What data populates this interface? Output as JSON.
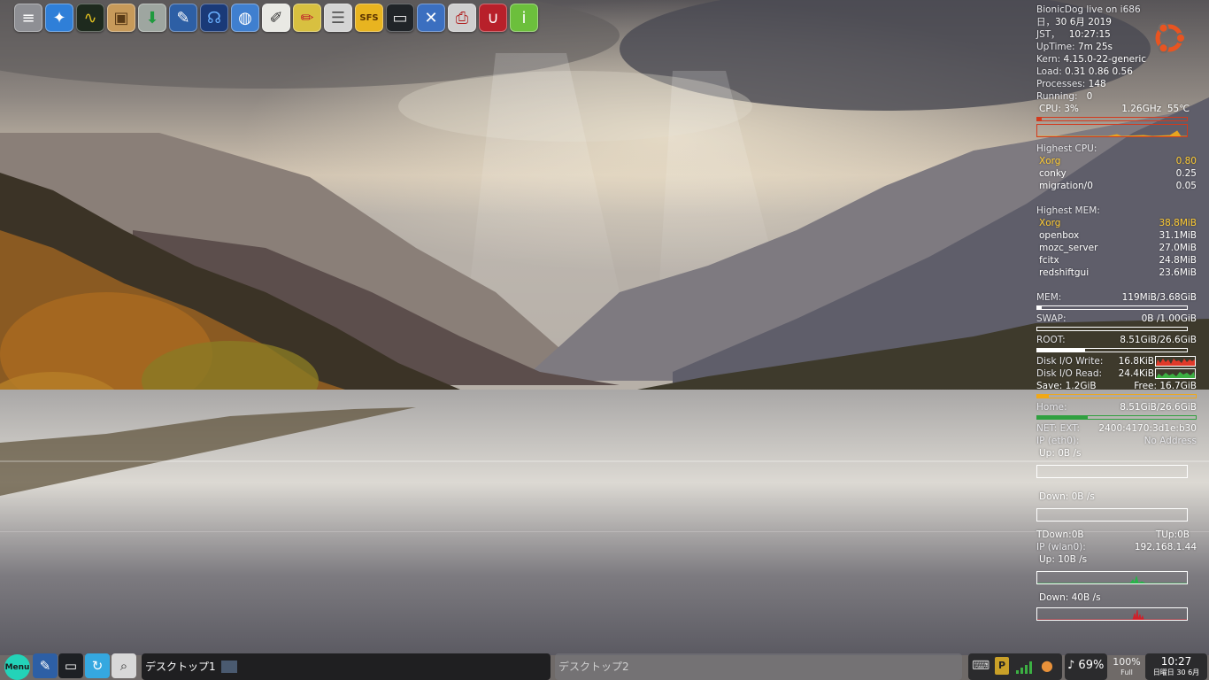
{
  "launcher": {
    "icons": [
      {
        "name": "mixer-icon",
        "glyph": "≡",
        "bg": "#8e8f94",
        "fg": "#ffffff"
      },
      {
        "name": "browser-compass-icon",
        "glyph": "✦",
        "bg": "#2f7fd8",
        "fg": "#ffffff"
      },
      {
        "name": "system-monitor-icon",
        "glyph": "∿",
        "bg": "#1e2a1e",
        "fg": "#e0c020"
      },
      {
        "name": "package-box-icon",
        "glyph": "▣",
        "bg": "#c79a5a",
        "fg": "#5a3b16"
      },
      {
        "name": "download-icon",
        "glyph": "⬇",
        "bg": "#9ea6a0",
        "fg": "#1f9a3e"
      },
      {
        "name": "file-manager-icon",
        "glyph": "✎",
        "bg": "#2d5fa5",
        "fg": "#ffffff"
      },
      {
        "name": "headphones-icon",
        "glyph": "☊",
        "bg": "#1a3a78",
        "fg": "#6ab0ff"
      },
      {
        "name": "network-globe-icon",
        "glyph": "◍",
        "bg": "#3f7fcf",
        "fg": "#ffffff"
      },
      {
        "name": "text-editor-icon",
        "glyph": "✐",
        "bg": "#e9e9e4",
        "fg": "#333333"
      },
      {
        "name": "pencils-icon",
        "glyph": "✏",
        "bg": "#d8c040",
        "fg": "#c0202a"
      },
      {
        "name": "cabinet-icon",
        "glyph": "☰",
        "bg": "#d4d4d4",
        "fg": "#555555"
      },
      {
        "name": "sfs-lock-icon",
        "glyph": "SFS",
        "bg": "#e8b420",
        "fg": "#5a3200"
      },
      {
        "name": "terminal-icon",
        "glyph": "▭",
        "bg": "#202428",
        "fg": "#e8e8e8"
      },
      {
        "name": "network-x-icon",
        "glyph": "✕",
        "bg": "#3b6fc0",
        "fg": "#ffffff"
      },
      {
        "name": "printer-icon",
        "glyph": "⎙",
        "bg": "#cfcfcf",
        "fg": "#b02020"
      },
      {
        "name": "magnet-icon",
        "glyph": "∪",
        "bg": "#b8202a",
        "fg": "#ffffff"
      },
      {
        "name": "info-icon",
        "glyph": "i",
        "bg": "#6cbf3c",
        "fg": "#ffffff"
      }
    ]
  },
  "conky": {
    "hostline": "BionicDog live on i686",
    "date_prefix": "日，",
    "date_value": "30 6月 2019",
    "tz_prefix": "JST，",
    "time_value": "10:27:15",
    "uptime_label": "UpTime:",
    "uptime_value": "7m 25s",
    "kern_label": "Kern:",
    "kern_value": "4.15.0-22-generic",
    "load_label": "Load:",
    "load_value": "0.31 0.86 0.56",
    "processes_label": "Processes:",
    "processes_value": "148",
    "running_label": "Running:",
    "running_value": "0",
    "cpu_label": "CPU: 3%",
    "cpu_freq": "1.26GHz",
    "cpu_temp": "55℃",
    "cpu_fraction": 0.03,
    "highest_cpu_title": "Highest CPU:",
    "highest_cpu": [
      {
        "name": "Xorg",
        "value": "0.80",
        "hl": true
      },
      {
        "name": "conky",
        "value": "0.25",
        "hl": false
      },
      {
        "name": "migration/0",
        "value": "0.05",
        "hl": false
      }
    ],
    "highest_mem_title": "Highest MEM:",
    "highest_mem": [
      {
        "name": "Xorg",
        "value": "38.8MiB",
        "hl": true
      },
      {
        "name": "openbox",
        "value": "31.1MiB",
        "hl": false
      },
      {
        "name": "mozc_server",
        "value": "27.0MiB",
        "hl": false
      },
      {
        "name": "fcitx",
        "value": "24.8MiB",
        "hl": false
      },
      {
        "name": "redshiftgui",
        "value": "23.6MiB",
        "hl": false
      }
    ],
    "mem_label": "MEM:",
    "mem_value": "119MiB/3.68GiB",
    "mem_fraction": 0.03,
    "swap_label": "SWAP:",
    "swap_value": "0B /1.00GiB",
    "swap_fraction": 0.0,
    "root_label": "ROOT:",
    "root_value": "8.51GiB/26.6GiB",
    "root_fraction": 0.32,
    "diskio_write_label": "Disk I/O Write:",
    "diskio_write_value": "16.8KiB",
    "diskio_read_label": "Disk I/O Read:",
    "diskio_read_value": "24.4KiB",
    "save_label": "Save: 1.2GiB",
    "free_label": "Free: 16.7GiB",
    "save_fraction": 0.07,
    "home_label": "Home:",
    "home_value": "8.51GiB/26.6GiB",
    "home_fraction": 0.32,
    "net_ext_label": "NET: EXT:",
    "net_ext_value": "2400:4170:3d1e:b30",
    "ip_eth_label": "IP (eth0):",
    "ip_eth_value": "No Address",
    "eth_up": "Up: 0B  /s",
    "eth_down": "Down: 0B  /s",
    "tdown": "TDown:0B",
    "tup": "TUp:0B",
    "ip_wlan_label": "IP (wlan0):",
    "ip_wlan_value": "192.168.1.44",
    "wlan_up": "Up: 10B  /s",
    "wlan_down": "Down: 40B  /s",
    "colors": {
      "cpu": "#d23a1e",
      "write": "#e03a2a",
      "read": "#3cb043",
      "save": "#f0a818",
      "home": "#30a040",
      "net_up": "#29b34a",
      "net_down": "#d0202a"
    }
  },
  "taskbar": {
    "menu_label": "Menu",
    "quick": [
      {
        "name": "file-manager-icon",
        "glyph": "✎",
        "bg": "#2d5fa5"
      },
      {
        "name": "terminal-icon",
        "glyph": "▭",
        "bg": "#1d2024"
      },
      {
        "name": "refresh-icon",
        "glyph": "↻",
        "bg": "#35a8e0"
      },
      {
        "name": "search-icon",
        "glyph": "⌕",
        "bg": "#d8d8d8"
      }
    ],
    "desktop1": "デスクトップ1",
    "desktop2": "デスクトップ2",
    "volume": "♪ 69%",
    "battery_pct": "100%",
    "battery_state": "Full",
    "clock_time": "10:27",
    "clock_date": "日曜日 30 6月"
  }
}
